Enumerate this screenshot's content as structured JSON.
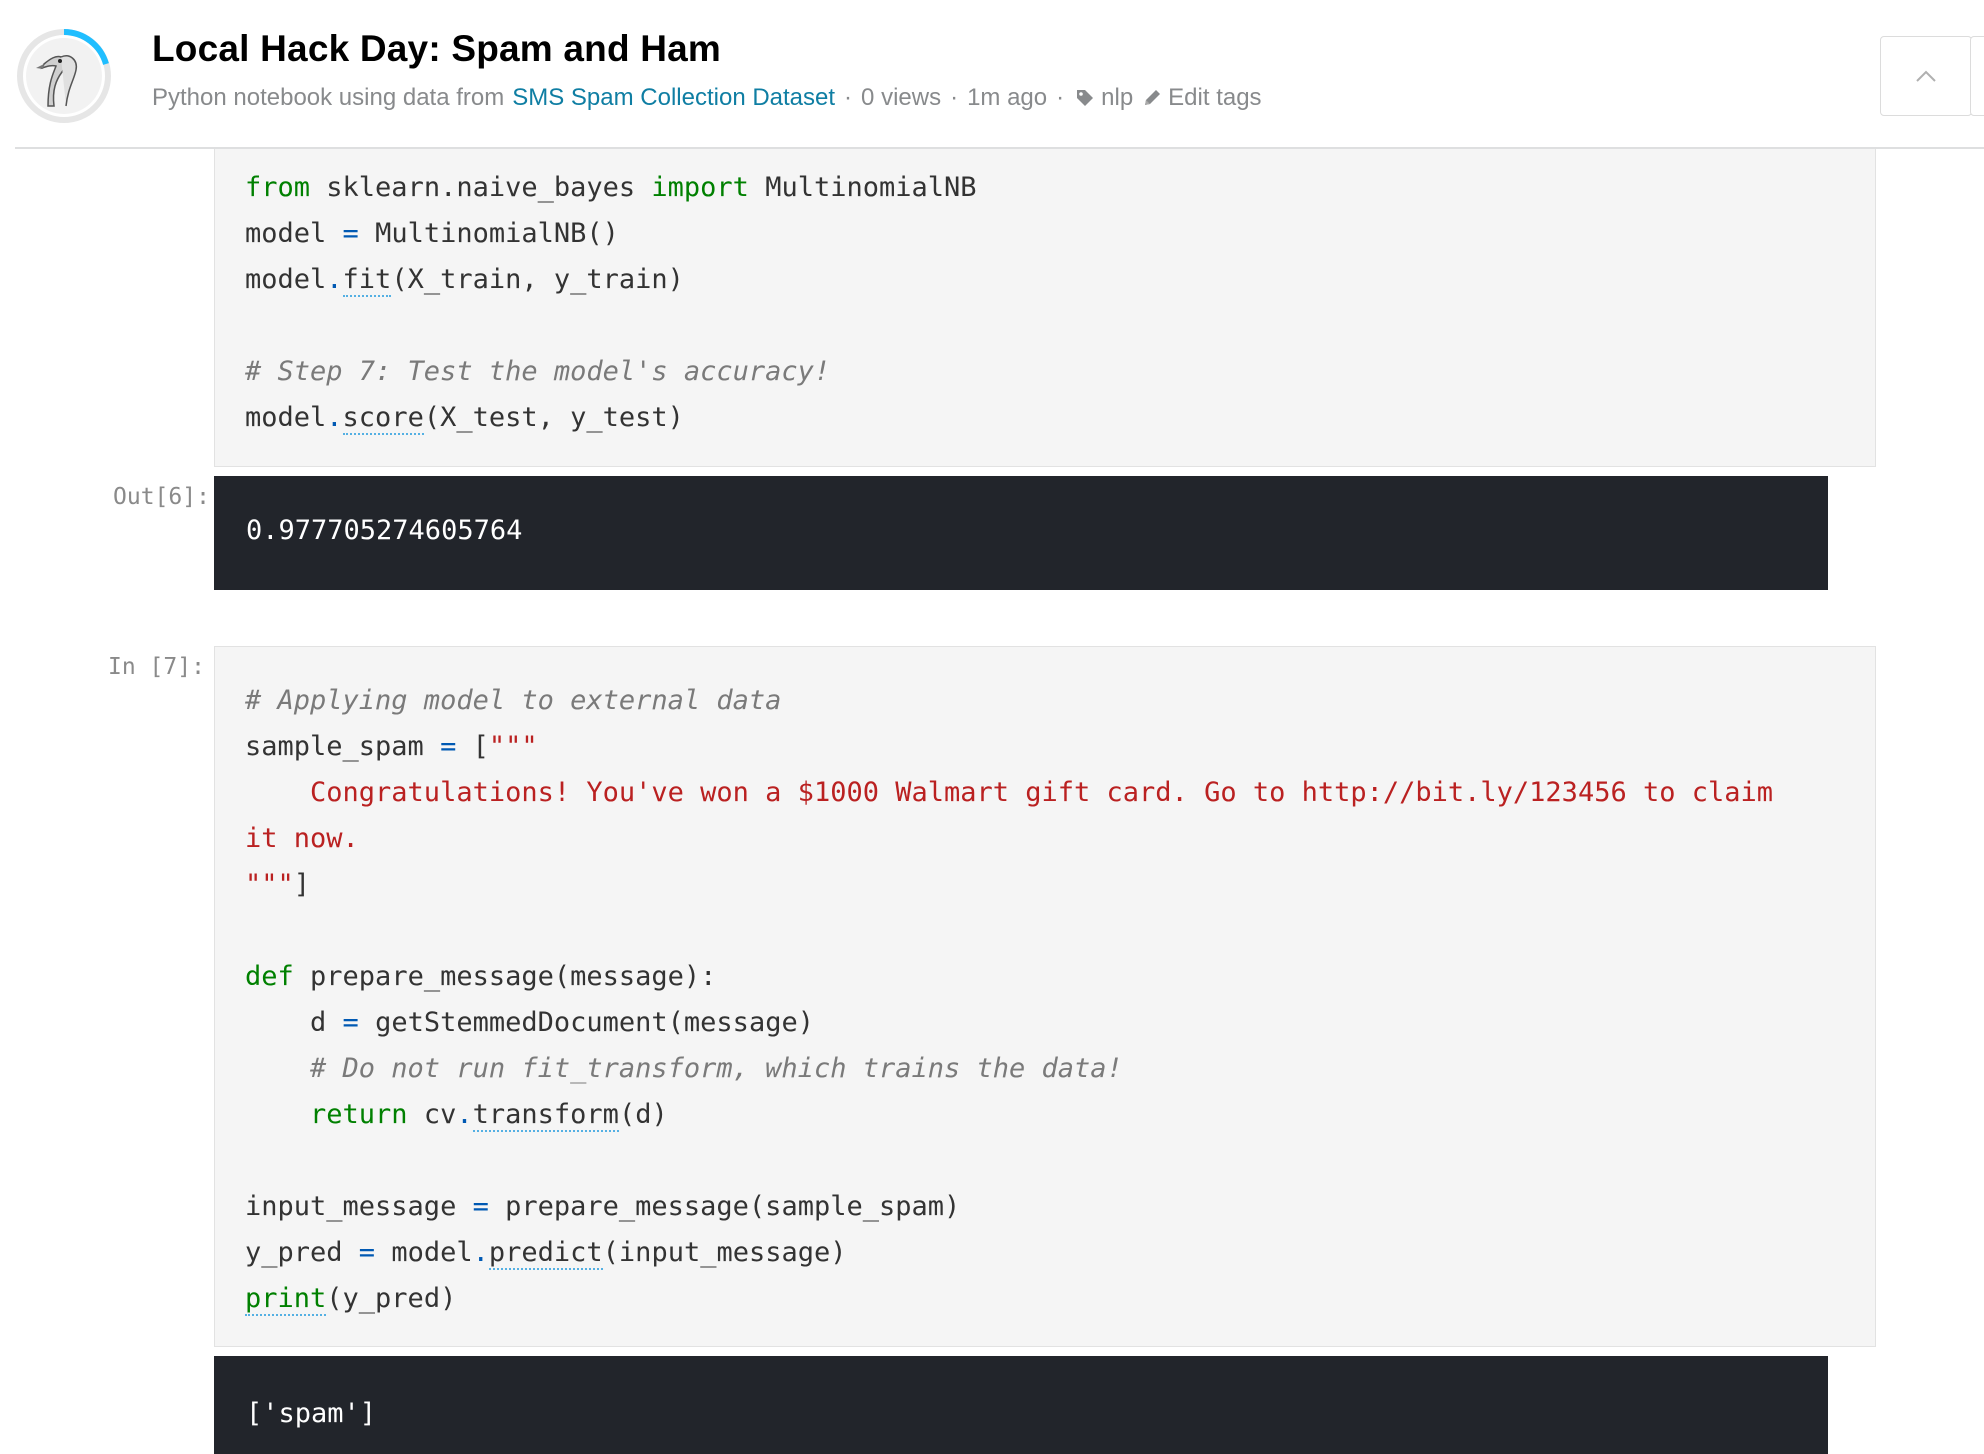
{
  "header": {
    "title": "Local Hack Day: Spam and Ham",
    "meta_prefix": "Python notebook using data from",
    "dataset_link": "SMS Spam Collection Dataset",
    "views": "0 views",
    "time": "1m ago",
    "tag": "nlp",
    "edit_tags": "Edit tags",
    "separator": "·",
    "icons": [
      "user-avatar",
      "tag-icon",
      "pencil-icon",
      "chevron-up-icon"
    ],
    "accent_color": "#20beff"
  },
  "cells": {
    "cell6_code": {
      "lines": [
        {
          "tokens": [
            {
              "t": "from",
              "c": "kw"
            },
            {
              "t": " sklearn.naive_bayes "
            },
            {
              "t": "import",
              "c": "kw"
            },
            {
              "t": " MultinomialNB"
            }
          ]
        },
        {
          "tokens": [
            {
              "t": "model "
            },
            {
              "t": "=",
              "c": "op"
            },
            {
              "t": " MultinomialNB()"
            }
          ]
        },
        {
          "tokens": [
            {
              "t": "model"
            },
            {
              "t": ".",
              "c": "op"
            },
            {
              "t": "fit",
              "c": "fn"
            },
            {
              "t": "(X_train, y_train)"
            }
          ]
        },
        {
          "tokens": []
        },
        {
          "tokens": [
            {
              "t": "# Step 7: Test the model's accuracy!",
              "c": "cm"
            }
          ]
        },
        {
          "tokens": [
            {
              "t": "model"
            },
            {
              "t": ".",
              "c": "op"
            },
            {
              "t": "score",
              "c": "fn"
            },
            {
              "t": "(X_test, y_test)"
            }
          ]
        }
      ]
    },
    "cell6_output": {
      "prompt": "Out[6]:",
      "text": "0.977705274605764"
    },
    "cell7_code": {
      "prompt": "In [7]:",
      "lines": [
        {
          "tokens": [
            {
              "t": "# Applying model to external data",
              "c": "cm"
            }
          ]
        },
        {
          "tokens": [
            {
              "t": "sample_spam "
            },
            {
              "t": "=",
              "c": "op"
            },
            {
              "t": " ["
            },
            {
              "t": "\"\"\"",
              "c": "st"
            }
          ]
        },
        {
          "tokens": [
            {
              "t": "    Congratulations! You've won a $1000 Walmart gift card. Go to http://bit.ly/123456 to claim",
              "c": "st"
            }
          ]
        },
        {
          "tokens": [
            {
              "t": "it now.",
              "c": "st"
            }
          ]
        },
        {
          "tokens": [
            {
              "t": "\"\"\"",
              "c": "st"
            },
            {
              "t": "]"
            }
          ]
        },
        {
          "tokens": []
        },
        {
          "tokens": [
            {
              "t": "def",
              "c": "kw"
            },
            {
              "t": " prepare_message(message):"
            }
          ]
        },
        {
          "tokens": [
            {
              "t": "    d "
            },
            {
              "t": "=",
              "c": "op"
            },
            {
              "t": " getStemmedDocument(message)"
            }
          ]
        },
        {
          "tokens": [
            {
              "t": "    # Do not run fit_transform, which trains the data!",
              "c": "cm"
            }
          ]
        },
        {
          "tokens": [
            {
              "t": "    "
            },
            {
              "t": "return",
              "c": "kw"
            },
            {
              "t": " cv"
            },
            {
              "t": ".",
              "c": "op"
            },
            {
              "t": "transform",
              "c": "fn"
            },
            {
              "t": "(d)"
            }
          ]
        },
        {
          "tokens": []
        },
        {
          "tokens": [
            {
              "t": "input_message "
            },
            {
              "t": "=",
              "c": "op"
            },
            {
              "t": " prepare_message(sample_spam)"
            }
          ]
        },
        {
          "tokens": [
            {
              "t": "y_pred "
            },
            {
              "t": "=",
              "c": "op"
            },
            {
              "t": " model"
            },
            {
              "t": ".",
              "c": "op"
            },
            {
              "t": "predict",
              "c": "fn"
            },
            {
              "t": "(input_message)"
            }
          ]
        },
        {
          "tokens": [
            {
              "t": "print",
              "c": "kw fn"
            },
            {
              "t": "(y_pred)"
            }
          ]
        }
      ]
    },
    "cell7_output": {
      "text": "['spam']"
    }
  }
}
